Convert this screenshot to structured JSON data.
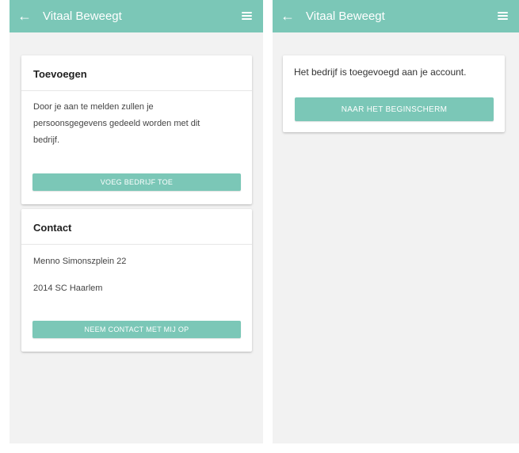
{
  "left": {
    "appbar": {
      "title": "Vitaal Beweegt",
      "back_icon": "arrow-left-icon",
      "menu_icon": "hamburger-menu-icon"
    },
    "add_card": {
      "title": "Toevoegen",
      "text": "Door je aan te melden zullen je persoonsgegevens gedeeld worden met dit bedrijf.",
      "button": "VOEG BEDRIJF TOE"
    },
    "contact_card": {
      "title": "Contact",
      "address_line1": "Menno Simonszplein 22",
      "address_line2": "2014 SC Haarlem",
      "button": "NEEM CONTACT MET MIJ OP"
    }
  },
  "right": {
    "appbar": {
      "title": "Vitaal Beweegt",
      "back_icon": "arrow-left-icon",
      "menu_icon": "hamburger-menu-icon"
    },
    "confirm_card": {
      "message": "Het bedrijf is toegevoegd aan je account.",
      "button": "NAAR HET BEGINSCHERM"
    }
  },
  "colors": {
    "accent": "#7bc7b7",
    "background": "#f2f2f2"
  }
}
